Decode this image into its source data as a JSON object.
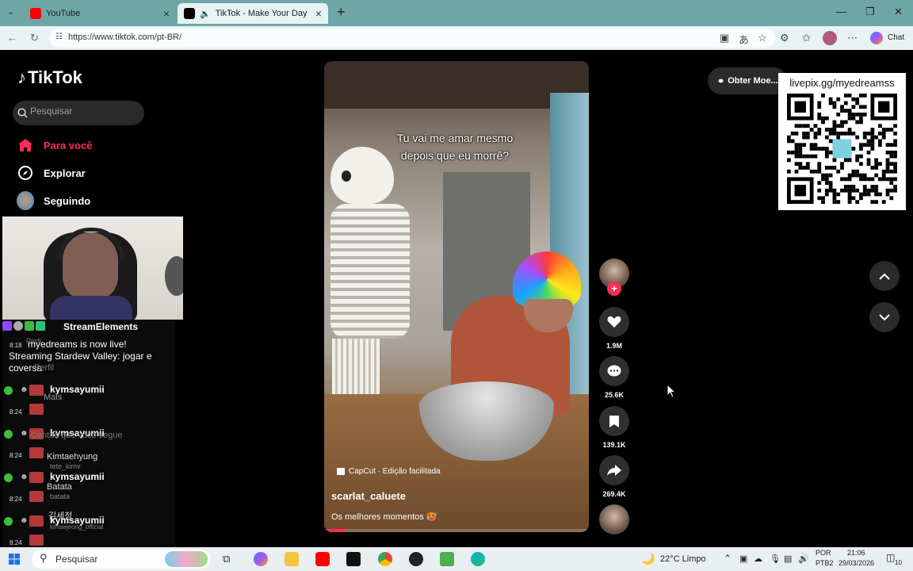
{
  "browser": {
    "tabs": [
      {
        "label": "YouTube",
        "active": false,
        "favicon_color": "#ff0000"
      },
      {
        "label": "TikTok - Make Your Day",
        "active": true,
        "favicon_color": "#000000"
      }
    ],
    "url": "https://www.tiktok.com/pt-BR/",
    "copilot_label": "Chat"
  },
  "tiktok": {
    "logo_text": "TikTok",
    "search_placeholder": "Pesquisar",
    "nav": [
      {
        "label": "Para você",
        "active": true,
        "icon": "home-icon"
      },
      {
        "label": "Explorar",
        "active": false,
        "icon": "compass-icon"
      },
      {
        "label": "Seguindo",
        "active": false,
        "icon": "following-avatar-icon"
      }
    ],
    "get_coins_label": "Obter Moe..."
  },
  "video": {
    "caption_line1": "Tu vai me amar mesmo",
    "caption_line2": "depois que eu morrê?",
    "capcut_label": "CapCut · Edição facilitada",
    "author": "scarlat_caluete",
    "description": "Os melhores momentos 🥵",
    "progress": 0.08
  },
  "actions": {
    "likes": "1.9M",
    "comments": "25.6K",
    "saves": "139.1K",
    "shares": "269.4K"
  },
  "overlay": {
    "qr_title": "livepix.gg/myedreamss",
    "stream_bot": "StreamElements",
    "live_message": "myedreams is now live! Streaming Stardew Valley: jogar e coversa",
    "live_time": "8:18",
    "chat_messages": [
      {
        "time": "8:24",
        "user": "kymsayumii"
      },
      {
        "time": "8:24",
        "user": "kymsayumii"
      },
      {
        "time": "8:24",
        "user": "kymsayumii"
      },
      {
        "time": "8:24",
        "user": "kymsayumii"
      }
    ],
    "ghost_texts": {
      "perfil": "Perfil",
      "mais": "Mais",
      "contas": "Contas que você segue",
      "acc1_name": "Kimtaehyung",
      "acc1_handle": "tete_kimv",
      "acc2_name": "Batata",
      "acc2_handle": "batata",
      "acc3_name": "김세정",
      "acc3_handle": "kimsejeong_official"
    }
  },
  "taskbar": {
    "search_label": "Pesquisar",
    "weather": "22°C  Limpo",
    "lang_top": "POR",
    "lang_bottom": "PTB2",
    "time": "21:06",
    "date": "29/03/2026",
    "notif_count": "10"
  }
}
